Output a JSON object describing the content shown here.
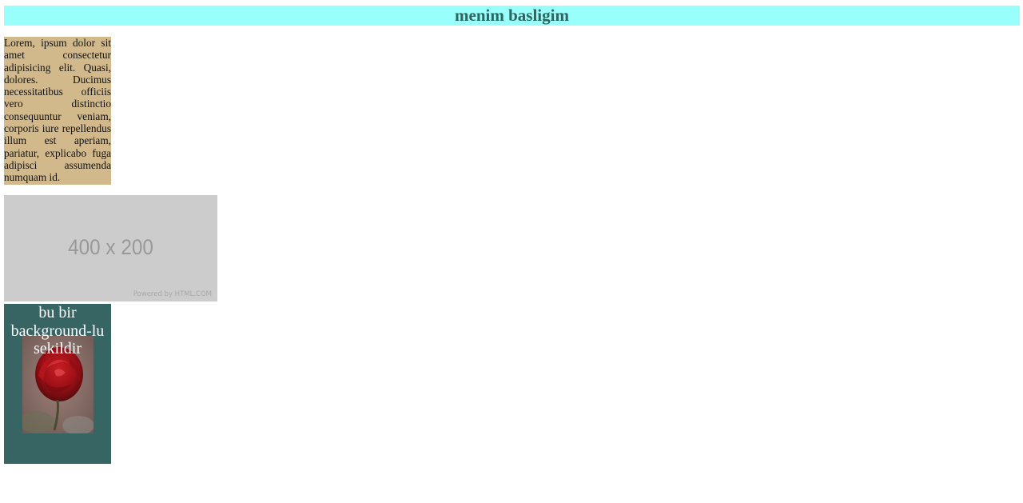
{
  "header": {
    "title": "menim basligim",
    "background": "#99fffa",
    "color": "#2f6461"
  },
  "text_box": {
    "paragraph": "Lorem, ipsum dolor sit amet consectetur adipisicing elit. Quasi, dolores. Ducimus necessitatibus officiis vero distinctio consequuntur veniam, corporis iure repellendus illum est aperiam, pariatur, explicabo fuga adipisci assumenda numquam id.",
    "background": "#d2b98c"
  },
  "placeholder_image": {
    "dimensions_label": "400 x 200",
    "powered_by": "Powered by HTML.COM",
    "background": "#cccccc"
  },
  "background_box": {
    "caption": "bu bir background-lu sekildir",
    "background": "#376564",
    "image_subject": "red-rose-photo"
  }
}
